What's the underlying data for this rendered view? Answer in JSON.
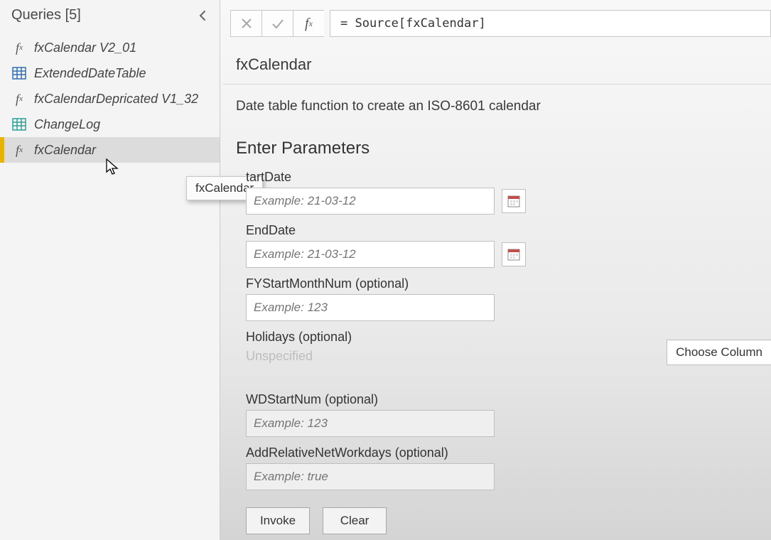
{
  "sidebar": {
    "title": "Queries [5]",
    "items": [
      {
        "label": "fxCalendar V2_01",
        "icon": "fx"
      },
      {
        "label": "ExtendedDateTable",
        "icon": "table-blue"
      },
      {
        "label": "fxCalendarDepricated V1_32",
        "icon": "fx"
      },
      {
        "label": "ChangeLog",
        "icon": "table-teal"
      },
      {
        "label": "fxCalendar",
        "icon": "fx",
        "selected": true
      }
    ],
    "tooltip": "fxCalendar"
  },
  "formula_bar": {
    "expression": "= Source[fxCalendar]"
  },
  "function": {
    "name": "fxCalendar",
    "description": "Date table function to create an ISO-8601 calendar",
    "parameters_heading": "Enter Parameters",
    "params": [
      {
        "label": "tartDate",
        "placeholder": "Example: 21-03-12",
        "date_picker": true
      },
      {
        "label": "EndDate",
        "placeholder": "Example: 21-03-12",
        "date_picker": true
      },
      {
        "label": "FYStartMonthNum (optional)",
        "placeholder": "Example: 123"
      },
      {
        "label": "Holidays (optional)",
        "unspecified_text": "Unspecified",
        "choose_column": true
      },
      {
        "label": "WDStartNum (optional)",
        "placeholder": "Example: 123",
        "disabled": true
      },
      {
        "label": "AddRelativeNetWorkdays (optional)",
        "placeholder": "Example: true",
        "disabled": true
      }
    ]
  },
  "buttons": {
    "invoke": "Invoke",
    "clear": "Clear",
    "choose_column": "Choose Column"
  },
  "colors": {
    "accent_selected": "#e8b200",
    "teal": "#2aa198",
    "blue": "#2f6fb5"
  }
}
